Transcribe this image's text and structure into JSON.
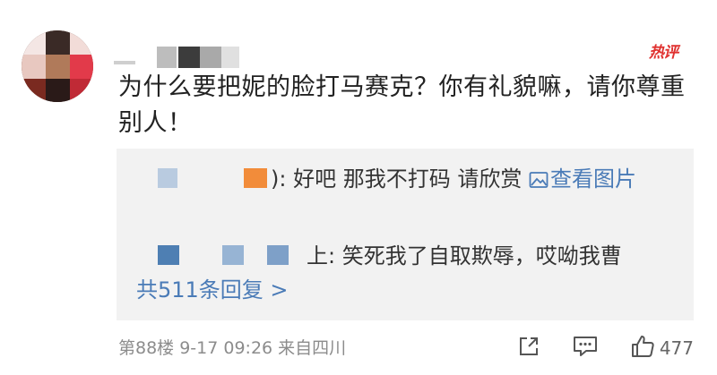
{
  "hot_tag": "热评",
  "comment": {
    "text": "为什么要把妮的脸打马赛克？你有礼貌嘛，请你尊重别人！"
  },
  "replies": [
    {
      "suffix": ")",
      "text": ": 好吧 那我不打码 请欣赏 ",
      "link_label": "查看图片"
    },
    {
      "suffix": "上",
      "text": ": 笑死我了自取欺辱，哎呦我曹"
    }
  ],
  "more_replies_label": "共511条回复 >",
  "footer": {
    "meta": "第88楼  9-17 09:26  来自四川",
    "like_count": "477"
  },
  "colors": {
    "hot": "#e0312f",
    "link": "#4a7bb7",
    "meta": "#8c8c8c",
    "reply_bg": "#f2f2f2"
  },
  "icons": [
    "share-icon",
    "comment-icon",
    "like-icon",
    "picture-icon"
  ]
}
